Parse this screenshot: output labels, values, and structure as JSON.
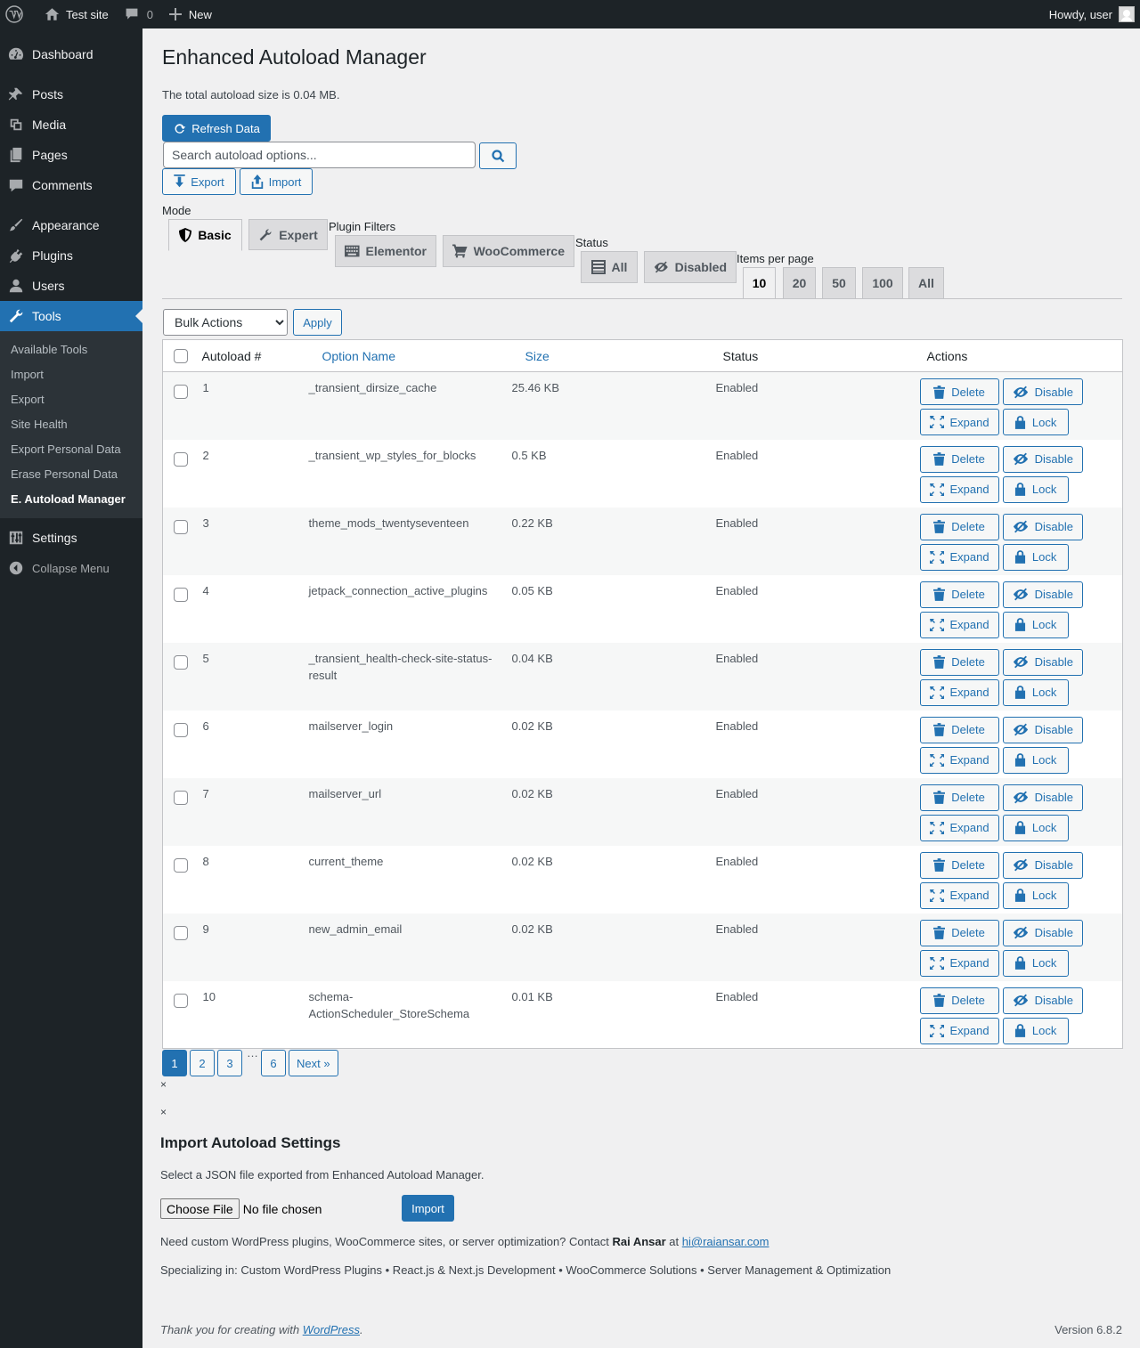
{
  "admin_bar": {
    "site_name": "Test site",
    "comments_count": "0",
    "new_label": "New",
    "howdy": "Howdy, user"
  },
  "sidebar": {
    "items_top": [
      {
        "label": "Dashboard",
        "icon": "dashboard-icon"
      }
    ],
    "items_mid": [
      {
        "label": "Posts",
        "icon": "pin-icon"
      },
      {
        "label": "Media",
        "icon": "media-icon"
      },
      {
        "label": "Pages",
        "icon": "pages-icon"
      },
      {
        "label": "Comments",
        "icon": "comment-icon"
      }
    ],
    "items_low": [
      {
        "label": "Appearance",
        "icon": "brush-icon"
      },
      {
        "label": "Plugins",
        "icon": "plugin-icon"
      },
      {
        "label": "Users",
        "icon": "user-icon"
      },
      {
        "label": "Tools",
        "icon": "wrench-icon"
      }
    ],
    "tools_submenu": [
      "Available Tools",
      "Import",
      "Export",
      "Site Health",
      "Export Personal Data",
      "Erase Personal Data",
      "E. Autoload Manager"
    ],
    "settings_label": "Settings",
    "collapse_label": "Collapse Menu"
  },
  "page": {
    "title": "Enhanced Autoload Manager",
    "total_size": "The total autoload size is 0.04 MB.",
    "refresh_label": "Refresh Data",
    "search_placeholder": "Search autoload options...",
    "export_label": "Export",
    "import_label": "Import"
  },
  "filters": {
    "mode_label": "Mode",
    "mode_tabs": [
      "Basic",
      "Expert"
    ],
    "plugin_filters_label": "Plugin Filters",
    "plugin_tabs": [
      "Elementor",
      "WooCommerce"
    ],
    "status_label": "Status",
    "status_tabs": [
      "All",
      "Disabled"
    ],
    "items_per_page_label": "Items per page",
    "per_page_tabs": [
      "10",
      "20",
      "50",
      "100",
      "All"
    ],
    "active_per_page": "10"
  },
  "bulk": {
    "selected": "Bulk Actions",
    "apply_label": "Apply"
  },
  "table": {
    "headers": [
      "Autoload #",
      "Option Name",
      "Size",
      "Status",
      "Actions"
    ],
    "action_labels": {
      "delete": "Delete",
      "disable": "Disable",
      "expand": "Expand",
      "lock": "Lock"
    },
    "rows": [
      {
        "num": "1",
        "name": "_transient_dirsize_cache",
        "size": "25.46 KB",
        "status": "Enabled"
      },
      {
        "num": "2",
        "name": "_transient_wp_styles_for_blocks",
        "size": "0.5 KB",
        "status": "Enabled"
      },
      {
        "num": "3",
        "name": "theme_mods_twentyseventeen",
        "size": "0.22 KB",
        "status": "Enabled"
      },
      {
        "num": "4",
        "name": "jetpack_connection_active_plugins",
        "size": "0.05 KB",
        "status": "Enabled"
      },
      {
        "num": "5",
        "name": "_transient_health-check-site-status-result",
        "size": "0.04 KB",
        "status": "Enabled"
      },
      {
        "num": "6",
        "name": "mailserver_login",
        "size": "0.02 KB",
        "status": "Enabled"
      },
      {
        "num": "7",
        "name": "mailserver_url",
        "size": "0.02 KB",
        "status": "Enabled"
      },
      {
        "num": "8",
        "name": "current_theme",
        "size": "0.02 KB",
        "status": "Enabled"
      },
      {
        "num": "9",
        "name": "new_admin_email",
        "size": "0.02 KB",
        "status": "Enabled"
      },
      {
        "num": "10",
        "name": "schema-ActionScheduler_StoreSchema",
        "size": "0.01 KB",
        "status": "Enabled"
      }
    ]
  },
  "pagination": {
    "pages": [
      "1",
      "2",
      "3"
    ],
    "dots": "…",
    "last": "6",
    "next": "Next »",
    "current": "1"
  },
  "close_marks": [
    "×",
    "×"
  ],
  "import_section": {
    "title": "Import Autoload Settings",
    "desc": "Select a JSON file exported from Enhanced Autoload Manager.",
    "choose_file": "Choose File",
    "no_file": "No file chosen",
    "import_button": "Import"
  },
  "credits": {
    "line1_prefix": "Need custom WordPress plugins, WooCommerce sites, or server optimization? Contact ",
    "line1_name": "Rai Ansar",
    "line1_at": " at ",
    "line1_email": "hi@raiansar.com",
    "line2": "Specializing in: Custom WordPress Plugins • React.js & Next.js Development • WooCommerce Solutions • Server Management & Optimization"
  },
  "footer": {
    "thanks_prefix": "Thank you for creating with ",
    "wordpress_link": "WordPress",
    "thanks_suffix": ".",
    "version": "Version 6.8.2"
  },
  "colors": {
    "accent": "#2271b1",
    "sidebar": "#1d2327",
    "background": "#f0f0f1"
  }
}
